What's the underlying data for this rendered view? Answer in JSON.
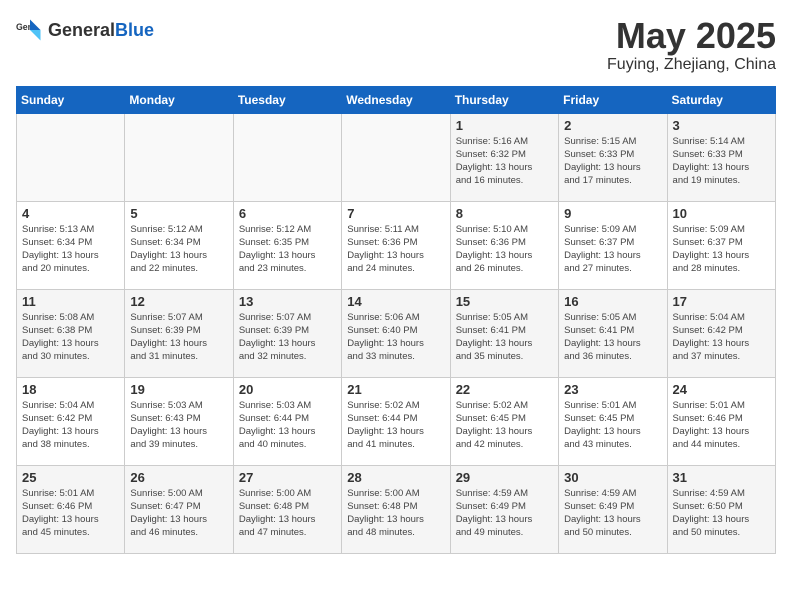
{
  "header": {
    "logo_general": "General",
    "logo_blue": "Blue",
    "title": "May 2025",
    "subtitle": "Fuying, Zhejiang, China"
  },
  "weekdays": [
    "Sunday",
    "Monday",
    "Tuesday",
    "Wednesday",
    "Thursday",
    "Friday",
    "Saturday"
  ],
  "weeks": [
    [
      {
        "day": "",
        "info": ""
      },
      {
        "day": "",
        "info": ""
      },
      {
        "day": "",
        "info": ""
      },
      {
        "day": "",
        "info": ""
      },
      {
        "day": "1",
        "info": "Sunrise: 5:16 AM\nSunset: 6:32 PM\nDaylight: 13 hours\nand 16 minutes."
      },
      {
        "day": "2",
        "info": "Sunrise: 5:15 AM\nSunset: 6:33 PM\nDaylight: 13 hours\nand 17 minutes."
      },
      {
        "day": "3",
        "info": "Sunrise: 5:14 AM\nSunset: 6:33 PM\nDaylight: 13 hours\nand 19 minutes."
      }
    ],
    [
      {
        "day": "4",
        "info": "Sunrise: 5:13 AM\nSunset: 6:34 PM\nDaylight: 13 hours\nand 20 minutes."
      },
      {
        "day": "5",
        "info": "Sunrise: 5:12 AM\nSunset: 6:34 PM\nDaylight: 13 hours\nand 22 minutes."
      },
      {
        "day": "6",
        "info": "Sunrise: 5:12 AM\nSunset: 6:35 PM\nDaylight: 13 hours\nand 23 minutes."
      },
      {
        "day": "7",
        "info": "Sunrise: 5:11 AM\nSunset: 6:36 PM\nDaylight: 13 hours\nand 24 minutes."
      },
      {
        "day": "8",
        "info": "Sunrise: 5:10 AM\nSunset: 6:36 PM\nDaylight: 13 hours\nand 26 minutes."
      },
      {
        "day": "9",
        "info": "Sunrise: 5:09 AM\nSunset: 6:37 PM\nDaylight: 13 hours\nand 27 minutes."
      },
      {
        "day": "10",
        "info": "Sunrise: 5:09 AM\nSunset: 6:37 PM\nDaylight: 13 hours\nand 28 minutes."
      }
    ],
    [
      {
        "day": "11",
        "info": "Sunrise: 5:08 AM\nSunset: 6:38 PM\nDaylight: 13 hours\nand 30 minutes."
      },
      {
        "day": "12",
        "info": "Sunrise: 5:07 AM\nSunset: 6:39 PM\nDaylight: 13 hours\nand 31 minutes."
      },
      {
        "day": "13",
        "info": "Sunrise: 5:07 AM\nSunset: 6:39 PM\nDaylight: 13 hours\nand 32 minutes."
      },
      {
        "day": "14",
        "info": "Sunrise: 5:06 AM\nSunset: 6:40 PM\nDaylight: 13 hours\nand 33 minutes."
      },
      {
        "day": "15",
        "info": "Sunrise: 5:05 AM\nSunset: 6:41 PM\nDaylight: 13 hours\nand 35 minutes."
      },
      {
        "day": "16",
        "info": "Sunrise: 5:05 AM\nSunset: 6:41 PM\nDaylight: 13 hours\nand 36 minutes."
      },
      {
        "day": "17",
        "info": "Sunrise: 5:04 AM\nSunset: 6:42 PM\nDaylight: 13 hours\nand 37 minutes."
      }
    ],
    [
      {
        "day": "18",
        "info": "Sunrise: 5:04 AM\nSunset: 6:42 PM\nDaylight: 13 hours\nand 38 minutes."
      },
      {
        "day": "19",
        "info": "Sunrise: 5:03 AM\nSunset: 6:43 PM\nDaylight: 13 hours\nand 39 minutes."
      },
      {
        "day": "20",
        "info": "Sunrise: 5:03 AM\nSunset: 6:44 PM\nDaylight: 13 hours\nand 40 minutes."
      },
      {
        "day": "21",
        "info": "Sunrise: 5:02 AM\nSunset: 6:44 PM\nDaylight: 13 hours\nand 41 minutes."
      },
      {
        "day": "22",
        "info": "Sunrise: 5:02 AM\nSunset: 6:45 PM\nDaylight: 13 hours\nand 42 minutes."
      },
      {
        "day": "23",
        "info": "Sunrise: 5:01 AM\nSunset: 6:45 PM\nDaylight: 13 hours\nand 43 minutes."
      },
      {
        "day": "24",
        "info": "Sunrise: 5:01 AM\nSunset: 6:46 PM\nDaylight: 13 hours\nand 44 minutes."
      }
    ],
    [
      {
        "day": "25",
        "info": "Sunrise: 5:01 AM\nSunset: 6:46 PM\nDaylight: 13 hours\nand 45 minutes."
      },
      {
        "day": "26",
        "info": "Sunrise: 5:00 AM\nSunset: 6:47 PM\nDaylight: 13 hours\nand 46 minutes."
      },
      {
        "day": "27",
        "info": "Sunrise: 5:00 AM\nSunset: 6:48 PM\nDaylight: 13 hours\nand 47 minutes."
      },
      {
        "day": "28",
        "info": "Sunrise: 5:00 AM\nSunset: 6:48 PM\nDaylight: 13 hours\nand 48 minutes."
      },
      {
        "day": "29",
        "info": "Sunrise: 4:59 AM\nSunset: 6:49 PM\nDaylight: 13 hours\nand 49 minutes."
      },
      {
        "day": "30",
        "info": "Sunrise: 4:59 AM\nSunset: 6:49 PM\nDaylight: 13 hours\nand 50 minutes."
      },
      {
        "day": "31",
        "info": "Sunrise: 4:59 AM\nSunset: 6:50 PM\nDaylight: 13 hours\nand 50 minutes."
      }
    ]
  ]
}
